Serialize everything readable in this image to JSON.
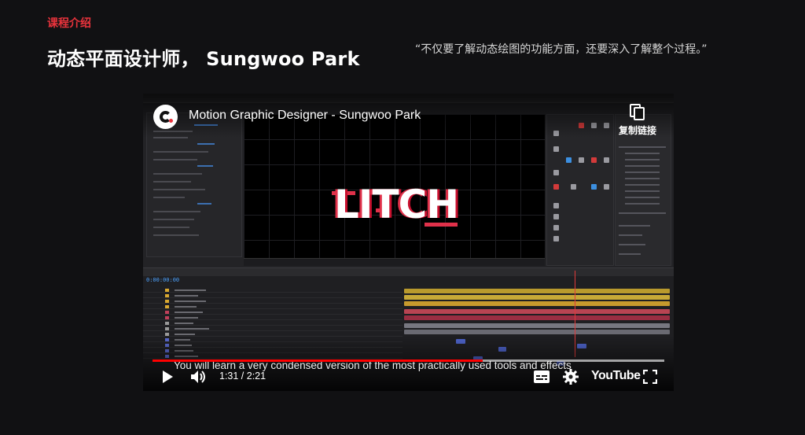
{
  "header": {
    "section_label": "课程介绍",
    "headline": "动态平面设计师， Sungwoo Park",
    "quote": "“不仅要了解动态绘图的功能方面，还要深入了解整个过程。”"
  },
  "video": {
    "title": "Motion Graphic Designer - Sungwoo Park",
    "copy_link_label": "复制链接",
    "comp_text": "LITCH",
    "timecode": "0:00:00:00",
    "caption": "You will learn a very condensed version of the most practically used tools and effects",
    "current_time": "1:31",
    "duration": "2:21",
    "time_display": "1:31 / 2:21",
    "progress_played": 0.645,
    "progress_buffered": 1.0,
    "brand": "YouTube",
    "icons": {
      "channel": "channel-logo-icon",
      "copy": "copy-icon",
      "play": "play-icon",
      "volume": "volume-icon",
      "cc": "closed-captions-icon",
      "settings": "gear-icon",
      "fullscreen": "fullscreen-icon"
    },
    "colors": {
      "accent": "#e8333c",
      "progress": "#ff0000"
    }
  }
}
